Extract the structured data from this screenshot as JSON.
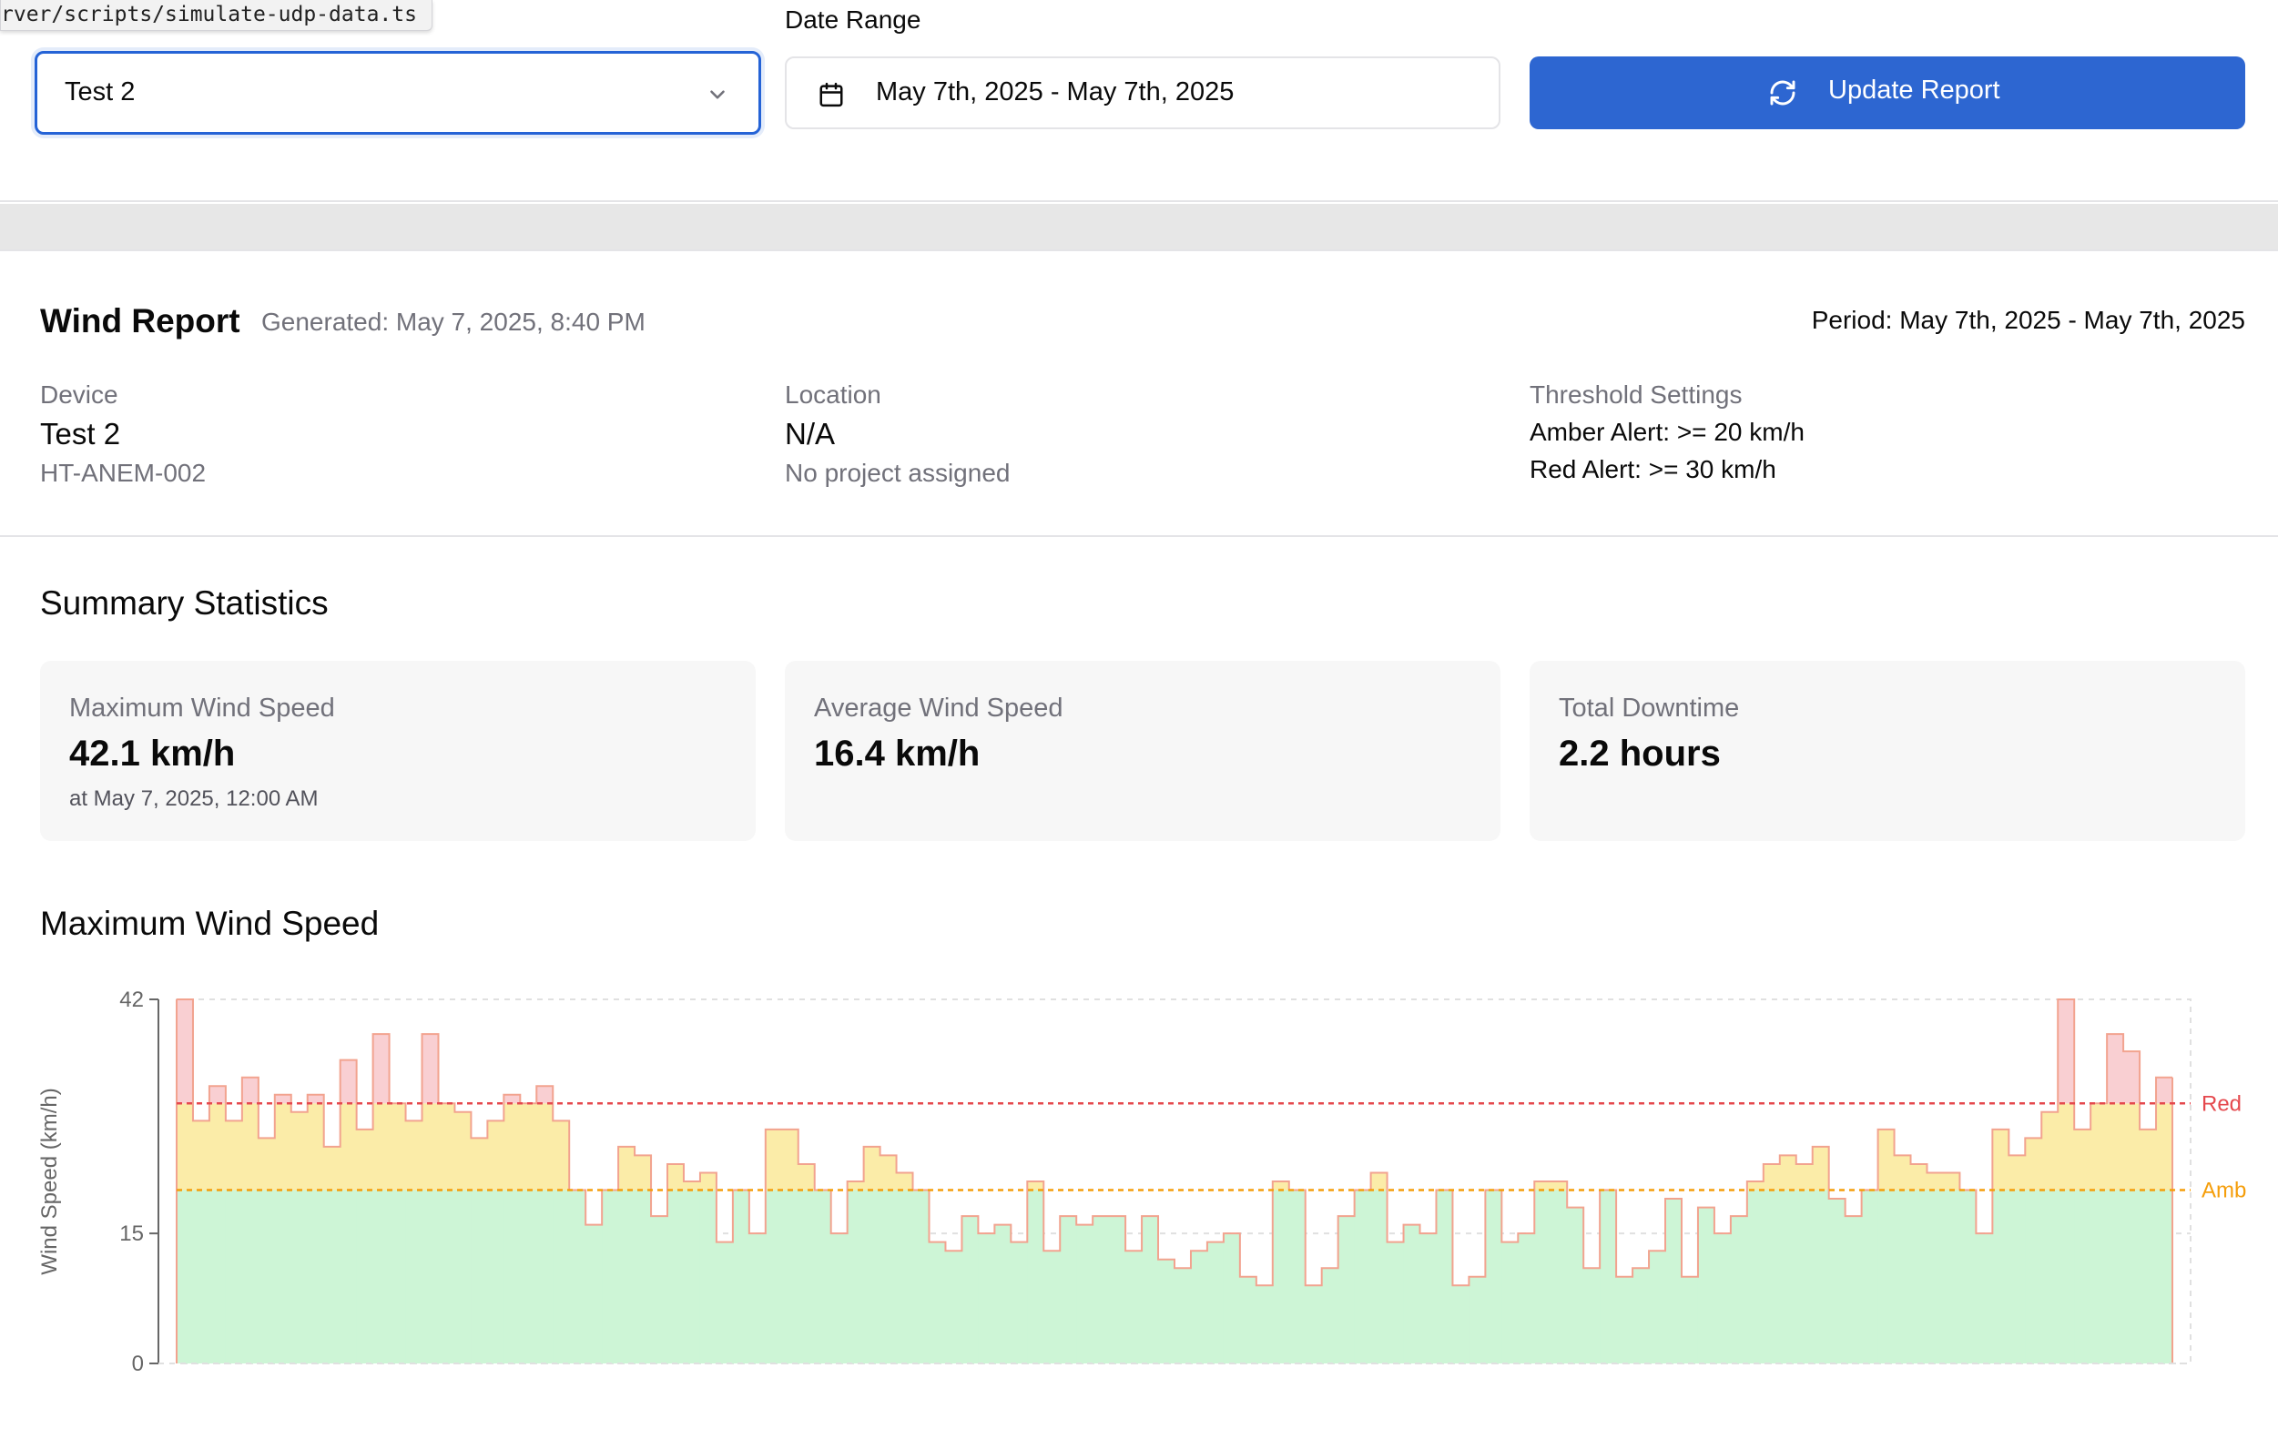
{
  "tooltip": "rver/scripts/simulate-udp-data.ts",
  "filters": {
    "date_range_label": "Date Range",
    "selected_device": "Test 2",
    "date_range_value": "May 7th, 2025 - May 7th, 2025",
    "update_button": "Update Report",
    "accent_color": "#2d66d1"
  },
  "report": {
    "title": "Wind Report",
    "generated": "Generated: May 7, 2025, 8:40 PM",
    "period": "Period: May 7th, 2025 - May 7th, 2025",
    "device": {
      "label": "Device",
      "name": "Test 2",
      "id": "HT-ANEM-002"
    },
    "location": {
      "label": "Location",
      "value": "N/A",
      "note": "No project assigned"
    },
    "thresholds": {
      "label": "Threshold Settings",
      "amber": "Amber Alert: >= 20 km/h",
      "red": "Red Alert: >= 30 km/h"
    }
  },
  "summary": {
    "title": "Summary Statistics",
    "cards": [
      {
        "label": "Maximum Wind Speed",
        "value": "42.1 km/h",
        "sub": "at May 7, 2025, 12:00 AM"
      },
      {
        "label": "Average Wind Speed",
        "value": "16.4 km/h"
      },
      {
        "label": "Total Downtime",
        "value": "2.2 hours"
      }
    ]
  },
  "chart_section_title": "Maximum Wind Speed",
  "chart_data": {
    "type": "area",
    "step": true,
    "title": "",
    "ylabel": "Wind Speed (km/h)",
    "xlabel": "",
    "ylim": [
      0,
      42
    ],
    "yticks": [
      0,
      15,
      42
    ],
    "grid": true,
    "thresholds": [
      {
        "name": "Red",
        "value": 30,
        "color": "#e5484d"
      },
      {
        "name": "Amb",
        "value": 20,
        "color": "#f59e0b"
      }
    ],
    "zone_colors": {
      "green": "#cdf5d6",
      "amber": "#fbeca8",
      "red": "#f9cfd2",
      "line": "#f2a38f"
    },
    "series": [
      {
        "values": [
          42,
          28,
          32,
          28,
          33,
          26,
          31,
          29,
          31,
          25,
          35,
          27,
          38,
          30,
          28,
          38,
          30,
          29,
          26,
          28,
          31,
          30,
          32,
          28,
          20,
          16,
          20,
          25,
          24,
          17,
          23,
          21,
          22,
          14,
          20,
          15,
          27,
          27,
          23,
          20,
          15,
          21,
          25,
          24,
          22,
          20,
          14,
          13,
          17,
          15,
          16,
          14,
          21,
          13,
          17,
          16,
          17,
          17,
          13,
          17,
          12,
          11,
          13,
          14,
          15,
          10,
          9,
          21,
          20,
          9,
          11,
          17,
          20,
          22,
          14,
          16,
          15,
          20,
          9,
          10,
          20,
          14,
          15,
          21,
          21,
          18,
          11,
          20,
          10,
          11,
          13,
          19,
          10,
          18,
          15,
          17,
          21,
          23,
          24,
          23,
          25,
          19,
          17,
          20,
          27,
          24,
          23,
          22,
          22,
          20,
          15,
          27,
          24,
          26,
          29,
          42,
          27,
          30,
          38,
          36,
          27,
          33
        ]
      }
    ]
  }
}
